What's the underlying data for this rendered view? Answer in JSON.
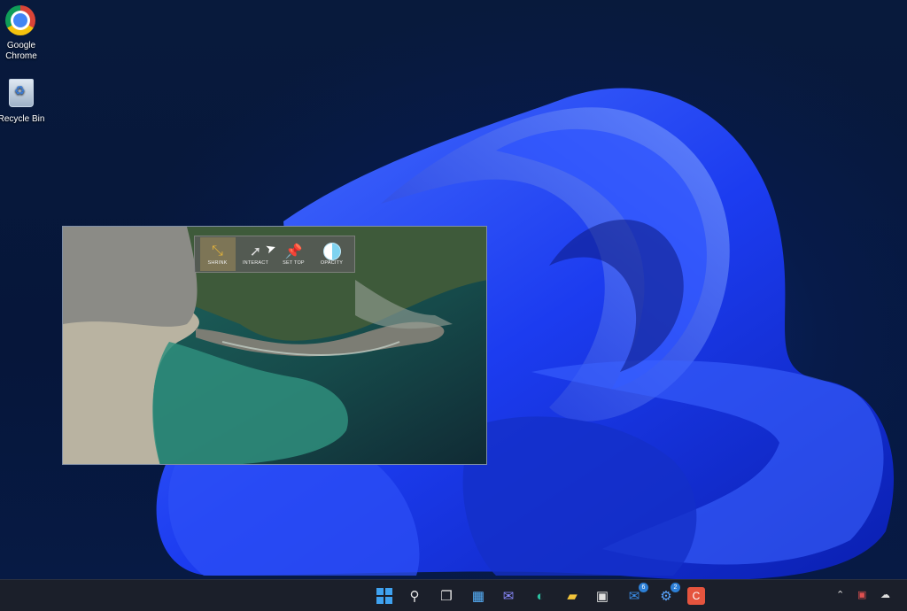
{
  "desktop": {
    "icons": [
      {
        "label": "Google\nChrome",
        "line1": "Google",
        "line2": "Chrome",
        "icon": "chrome-icon"
      },
      {
        "label": "Recycle Bin",
        "icon": "recycle-bin-icon"
      }
    ]
  },
  "overlay_window": {
    "toolbar": {
      "shrink_label": "SHRINK",
      "interact_label": "INTERACT",
      "set_top_label": "SET TOP",
      "opacity_label": "OPACITY"
    }
  },
  "taskbar": {
    "icons": [
      "windows-start-icon",
      "search-icon",
      "task-view-icon",
      "widgets-icon",
      "chat-icon",
      "edge-icon",
      "file-explorer-icon",
      "store-icon",
      "mail-icon",
      "app-icon",
      "app-red-icon"
    ],
    "mail_badge": "6",
    "app_badge": "2"
  },
  "colors": {
    "wallpaper_blue": "#1a3de0",
    "taskbar_bg": "#1b1f2a",
    "accent": "#3fa2f0"
  }
}
